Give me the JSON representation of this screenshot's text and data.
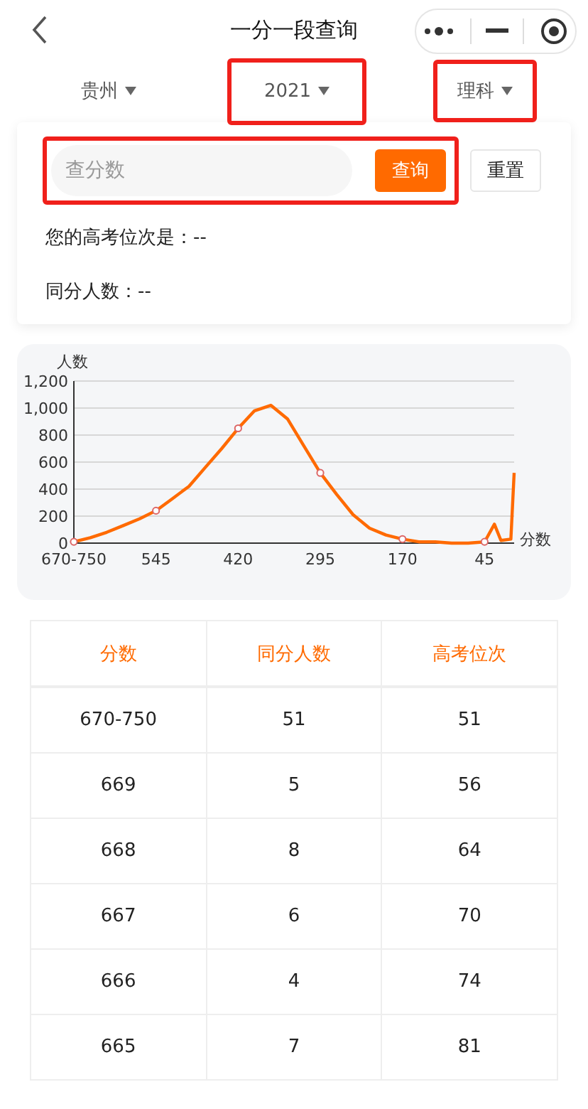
{
  "nav": {
    "title": "一分一段查询"
  },
  "filters": [
    {
      "label": "贵州",
      "highlighted": false
    },
    {
      "label": "2021",
      "highlighted": true
    },
    {
      "label": "理科",
      "highlighted": true
    }
  ],
  "search": {
    "placeholder": "查分数",
    "button": "查询",
    "highlighted": true
  },
  "reset_button": "重置",
  "results": [
    "您的高考位次是：--",
    "同分人数：--"
  ],
  "chart": {
    "chart_data": {
      "type": "line",
      "xlabel": "分数",
      "ylabel": "人数",
      "x": [
        670,
        645,
        620,
        595,
        570,
        545,
        520,
        495,
        470,
        445,
        420,
        395,
        370,
        345,
        320,
        295,
        270,
        245,
        220,
        195,
        170,
        145,
        120,
        95,
        70,
        45,
        30,
        20,
        5,
        0
      ],
      "grid": true,
      "series": [
        {
          "color": "#ff6a00",
          "values": [
            10,
            40,
            80,
            130,
            180,
            240,
            330,
            420,
            560,
            700,
            850,
            980,
            1020,
            920,
            720,
            520,
            360,
            210,
            110,
            60,
            30,
            10,
            10,
            0,
            0,
            10,
            140,
            20,
            30,
            520
          ]
        }
      ],
      "xlim": [
        670,
        0
      ],
      "ylim": [
        0,
        1200
      ],
      "xticks": [
        {
          "value": 670,
          "label": "670-750"
        },
        545,
        420,
        295,
        170,
        45
      ],
      "yticks": [
        {
          "value": 0,
          "label": "0"
        },
        {
          "value": 200,
          "label": "200"
        },
        {
          "value": 400,
          "label": "400"
        },
        {
          "value": 600,
          "label": "600"
        },
        {
          "value": 800,
          "label": "800"
        },
        {
          "value": 1000,
          "label": "1,000"
        },
        {
          "value": 1200,
          "label": "1,200"
        }
      ]
    }
  },
  "table": {
    "columns": [
      "分数",
      "同分人数",
      "高考位次"
    ],
    "rows": [
      [
        "670-750",
        "51",
        "51"
      ],
      [
        "669",
        "5",
        "56"
      ],
      [
        "668",
        "8",
        "64"
      ],
      [
        "667",
        "6",
        "70"
      ],
      [
        "666",
        "4",
        "74"
      ],
      [
        "665",
        "7",
        "81"
      ]
    ]
  }
}
